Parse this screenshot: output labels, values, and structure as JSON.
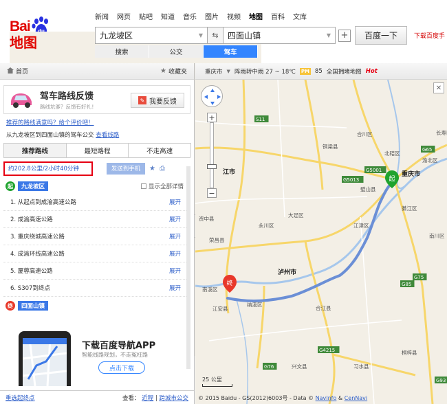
{
  "brand": {
    "bai": "Bai",
    "du": "du",
    "map": "地图"
  },
  "nav": [
    "新闻",
    "网页",
    "贴吧",
    "知道",
    "音乐",
    "图片",
    "视频",
    "地图",
    "百科",
    "文库"
  ],
  "nav_active_index": 7,
  "search": {
    "from": "九龙坡区",
    "to": "四面山镇",
    "swap_icon": "swap-arrows-icon",
    "add_icon": "plus-icon",
    "button": "百度一下",
    "download_link": "下载百度手"
  },
  "modes": [
    "搜索",
    "公交",
    "驾车"
  ],
  "modes_active_index": 2,
  "left_bar": {
    "home": "首页",
    "favorites": "收藏夹"
  },
  "feedback": {
    "title": "驾车路线反馈",
    "subtitle": "路线坑爹？反馈有好礼！",
    "button": "我要反馈"
  },
  "rating_link": "推荐的路线满意吗？给个评价吧！",
  "bus_line": {
    "text": "从九龙坡区到四面山镇的驾车公交",
    "link": "查看线路"
  },
  "route_tabs": [
    "推荐路线",
    "最短路程",
    "不走高速"
  ],
  "route_tabs_active_index": 0,
  "summary": {
    "distance": "约202.8公里/2小时40分钟",
    "send_button": "发送到手机",
    "star_icon": "star-icon",
    "print_icon": "print-icon"
  },
  "start": {
    "pin": "起",
    "name": "九龙坡区"
  },
  "show_all": "显示全部详情",
  "steps": [
    {
      "text": "1. 从起点到成渝高速公路",
      "action": "展开"
    },
    {
      "text": "2. 成渝高速公路",
      "action": "展开"
    },
    {
      "text": "3. 重庆绕城高速公路",
      "action": "展开"
    },
    {
      "text": "4. 成渝环线高速公路",
      "action": "展开"
    },
    {
      "text": "5. 厦蓉高速公路",
      "action": "展开"
    },
    {
      "text": "6. S307到终点",
      "action": "展开"
    }
  ],
  "end": {
    "pin": "终",
    "name": "四面山镇"
  },
  "ad": {
    "title": "下载百度导航APP",
    "subtitle": "智能线路规划，不走冤枉路",
    "button": "点击下载"
  },
  "bottom": {
    "reselect": "重选起终点",
    "view_label": "查看：",
    "nearby": "近程",
    "cross_city": "跨城市公交"
  },
  "map_bar": {
    "city": "重庆市",
    "weather": "阵雨转中雨 27 ~ 18℃",
    "pm_badge": "PM",
    "pm_value": "85",
    "traffic": "全国拥堵地图",
    "hot": "Hot"
  },
  "map_labels": [
    {
      "text": "江市",
      "kind": "city"
    },
    {
      "text": "重庆市",
      "kind": "city"
    },
    {
      "text": "泸州市",
      "kind": "city"
    },
    {
      "text": "大足区",
      "kind": "place"
    },
    {
      "text": "铜梁县",
      "kind": "place"
    },
    {
      "text": "合川区",
      "kind": "place"
    },
    {
      "text": "北碚区",
      "kind": "place"
    },
    {
      "text": "璧山县",
      "kind": "place"
    },
    {
      "text": "永川区",
      "kind": "place"
    },
    {
      "text": "荣昌县",
      "kind": "place"
    },
    {
      "text": "江津区",
      "kind": "place"
    },
    {
      "text": "綦江区",
      "kind": "place"
    },
    {
      "text": "南溪区",
      "kind": "place"
    },
    {
      "text": "江安县",
      "kind": "place"
    },
    {
      "text": "合江县",
      "kind": "place"
    },
    {
      "text": "习水县",
      "kind": "place"
    },
    {
      "text": "兴文县",
      "kind": "place"
    },
    {
      "text": "桐梓县",
      "kind": "place"
    },
    {
      "text": "渝北区",
      "kind": "place"
    },
    {
      "text": "长寿区",
      "kind": "place"
    },
    {
      "text": "南川区",
      "kind": "place"
    },
    {
      "text": "纳溪区",
      "kind": "place"
    },
    {
      "text": "资中县",
      "kind": "place"
    },
    {
      "text": "G5013",
      "kind": "road"
    },
    {
      "text": "G5001",
      "kind": "road"
    },
    {
      "text": "G65",
      "kind": "road"
    },
    {
      "text": "G75",
      "kind": "road"
    },
    {
      "text": "G76",
      "kind": "road"
    },
    {
      "text": "G4215",
      "kind": "road"
    },
    {
      "text": "S11",
      "kind": "road"
    },
    {
      "text": "G85",
      "kind": "road"
    },
    {
      "text": "G93",
      "kind": "road"
    }
  ],
  "map_start_pin": "起",
  "map_end_pin": "终",
  "scale": "25 公里",
  "copyright": {
    "text": "© 2015 Baidu - GS(2012)6003号 - Data ©",
    "navinfo": "NavInfo",
    "amp": "&",
    "cennavi": "CenNavi"
  },
  "colors": {
    "brand_red": "#e10601",
    "active_blue": "#3385ff",
    "route_blue": "#6b8fd6",
    "highlight_red": "#e60012"
  }
}
